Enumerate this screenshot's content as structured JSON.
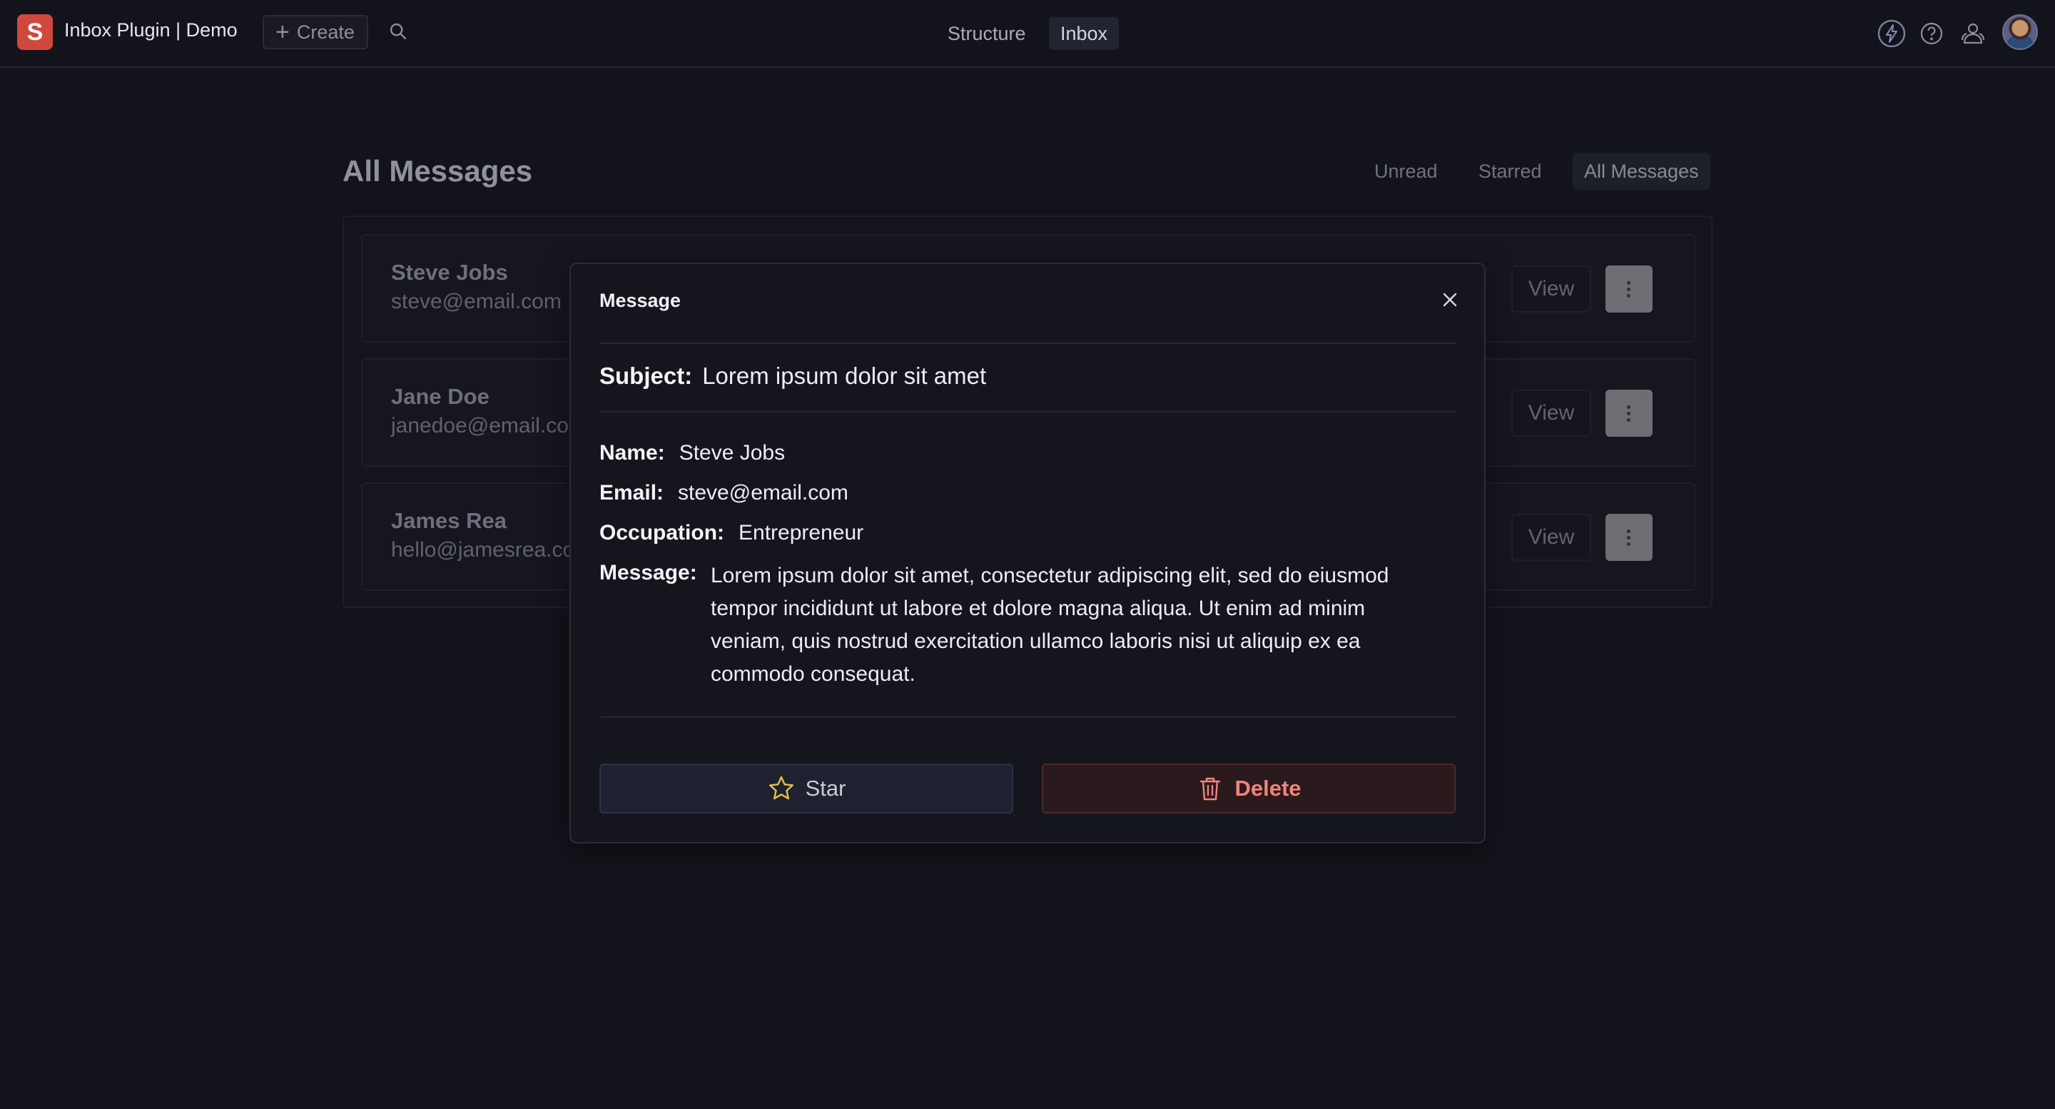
{
  "navbar": {
    "logo_letter": "S",
    "title": "Inbox Plugin | Demo",
    "create_label": "Create",
    "tabs": [
      {
        "label": "Structure",
        "active": false
      },
      {
        "label": "Inbox",
        "active": true
      }
    ],
    "icons": [
      "search-icon",
      "bolt-icon",
      "help-icon",
      "people-icon"
    ]
  },
  "page": {
    "title": "All Messages",
    "filters": [
      {
        "label": "Unread",
        "active": false
      },
      {
        "label": "Starred",
        "active": false
      },
      {
        "label": "All Messages",
        "active": true
      }
    ]
  },
  "messages": [
    {
      "name": "Steve Jobs",
      "email": "steve@email.com",
      "view_label": "View"
    },
    {
      "name": "Jane Doe",
      "email": "janedoe@email.com",
      "view_label": "View"
    },
    {
      "name": "James Rea",
      "email": "hello@jamesrea.co",
      "view_label": "View"
    }
  ],
  "modal": {
    "title": "Message",
    "subject_label": "Subject:",
    "subject": "Lorem ipsum dolor sit amet",
    "name_label": "Name:",
    "name": "Steve Jobs",
    "email_label": "Email:",
    "email": "steve@email.com",
    "occupation_label": "Occupation:",
    "occupation": "Entrepreneur",
    "message_label": "Message:",
    "message": "Lorem ipsum dolor sit amet, consectetur adipiscing elit, sed do eiusmod tempor incididunt ut labore et dolore magna aliqua. Ut enim ad minim veniam, quis nostrud exercitation ullamco laboris nisi ut aliquip ex ea commodo consequat.",
    "star_label": "Star",
    "delete_label": "Delete"
  },
  "colors": {
    "background": "#13141b",
    "brand": "#d0473c",
    "star_icon": "#e8c24a",
    "delete_text": "#f0857a"
  }
}
